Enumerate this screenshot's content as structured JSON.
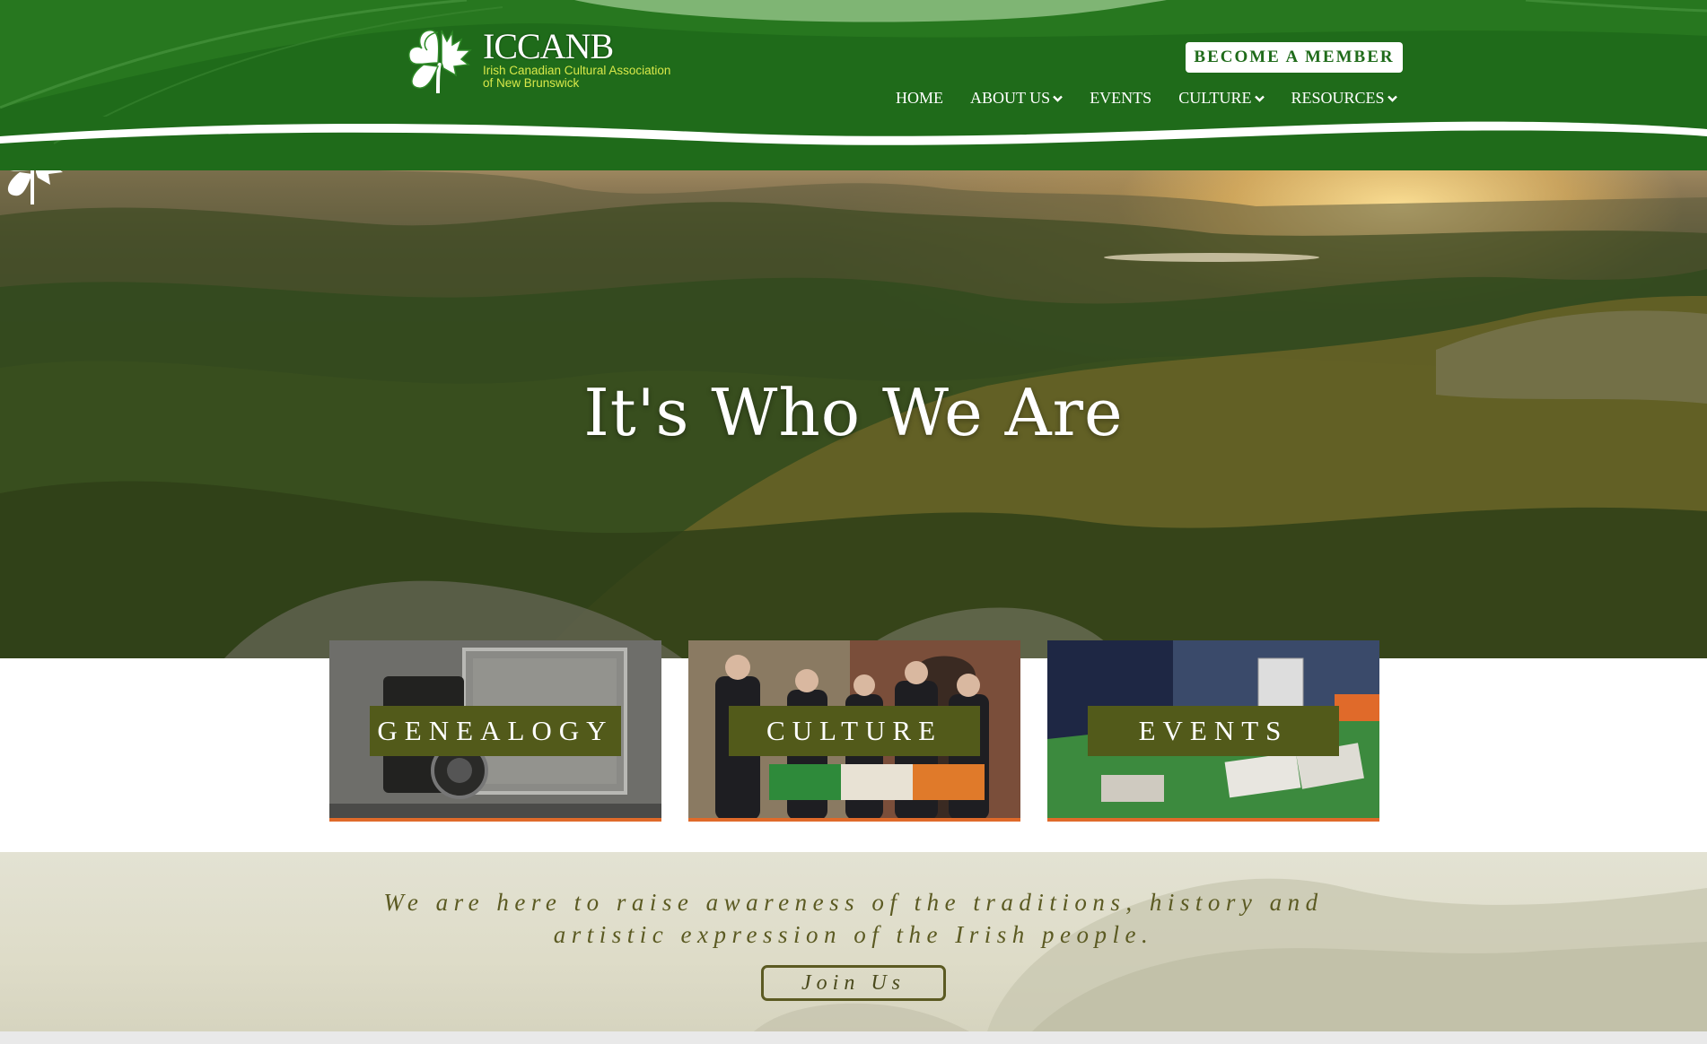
{
  "brand": {
    "name": "ICCANB",
    "subtitle_line1": "Irish Canadian Cultural Association",
    "subtitle_line2": "of New Brunswick"
  },
  "header": {
    "member_button": "BECOME A MEMBER",
    "nav": [
      {
        "label": "HOME",
        "dropdown": false
      },
      {
        "label": "ABOUT US",
        "dropdown": true
      },
      {
        "label": "EVENTS",
        "dropdown": false
      },
      {
        "label": "CULTURE",
        "dropdown": true
      },
      {
        "label": "RESOURCES",
        "dropdown": true
      }
    ]
  },
  "hero": {
    "title": "It's Who We Are",
    "icon": "shamrock-maple-leaf-icon"
  },
  "cards": [
    {
      "label": "GENEALOGY",
      "image": "vintage-camera-photo"
    },
    {
      "label": "CULTURE",
      "image": "group-with-irish-flag-photo"
    },
    {
      "label": "EVENTS",
      "image": "event-table-books-photo"
    }
  ],
  "mission": {
    "line1": "We are here to raise awareness of the traditions, history and",
    "line2": "artistic expression of the Irish people.",
    "join_button": "Join Us"
  },
  "colors": {
    "header_green": "#1f6b1a",
    "accent_orange": "#e06a2a",
    "card_label_bg": "#525a1a",
    "logo_yellow": "#d8e84a",
    "mission_text": "#5b5a22"
  }
}
